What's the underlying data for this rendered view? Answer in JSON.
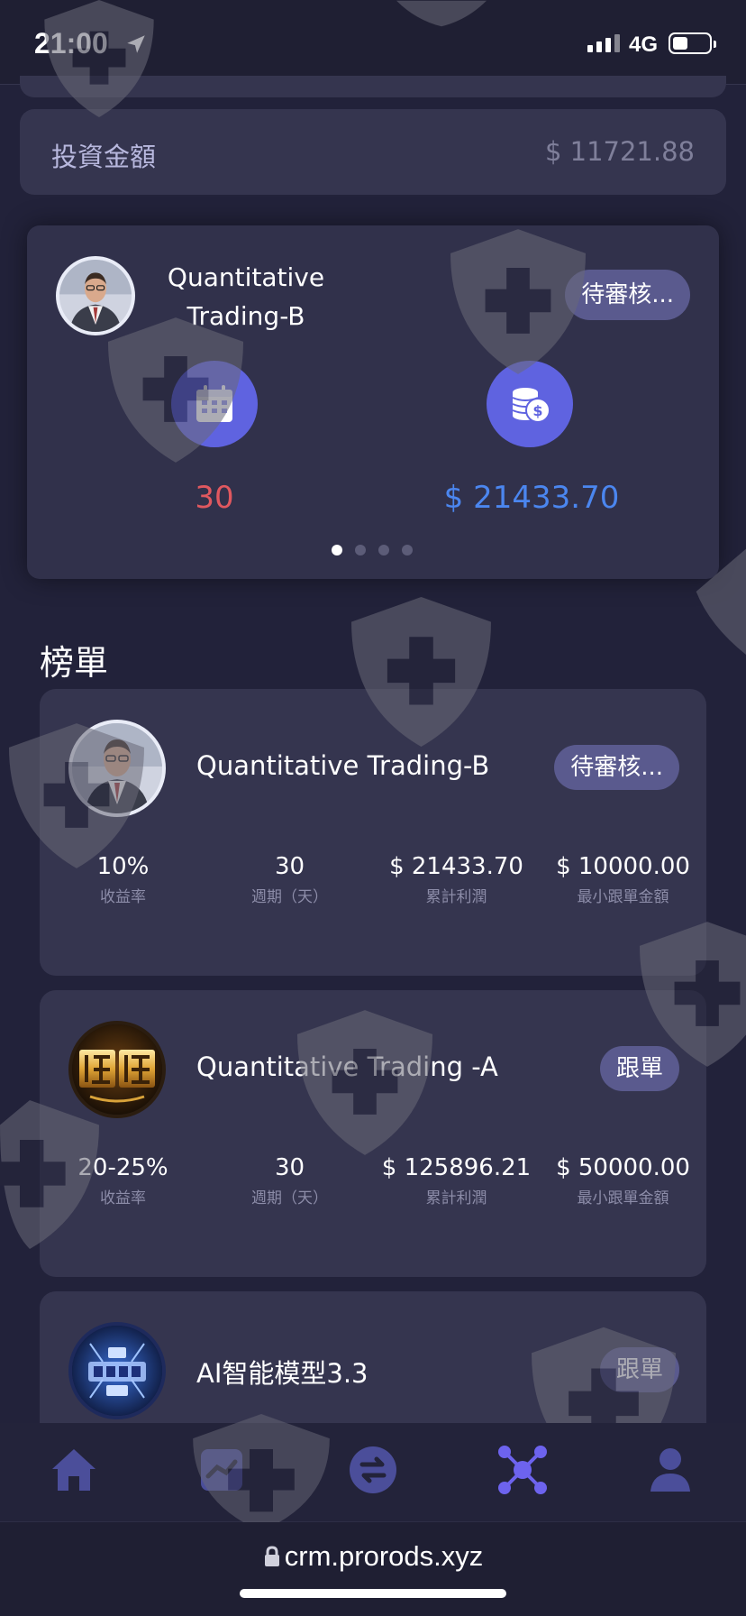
{
  "status": {
    "time": "21:00",
    "network": "4G"
  },
  "investment": {
    "label": "投資金額",
    "value": "$ 11721.88"
  },
  "carousel": {
    "title_line1": "Quantitative",
    "title_line2": "Trading-B",
    "status_label": "待審核...",
    "days": "30",
    "profit": "$ 21433.70",
    "page_count": 4,
    "active_page": 0
  },
  "leaderboard": {
    "title": "榜單",
    "items": [
      {
        "name": "Quantitative Trading-B",
        "action": "待審核...",
        "avatar": "portrait",
        "stats": [
          {
            "value": "10%",
            "label": "收益率"
          },
          {
            "value": "30",
            "label": "週期（天）"
          },
          {
            "value": "$ 21433.70",
            "label": "累計利潤"
          },
          {
            "value": "$ 10000.00",
            "label": "最小跟單金額"
          }
        ]
      },
      {
        "name": "Quantitative Trading -A",
        "action": "跟單",
        "avatar": "gold-logo",
        "stats": [
          {
            "value": "20-25%",
            "label": "收益率"
          },
          {
            "value": "30",
            "label": "週期（天）"
          },
          {
            "value": "$ 125896.21",
            "label": "累計利潤"
          },
          {
            "value": "$ 50000.00",
            "label": "最小跟單金額"
          }
        ]
      },
      {
        "name": "AI智能模型3.3",
        "action": "跟單",
        "avatar": "ai-logo"
      }
    ]
  },
  "tabs": [
    {
      "icon": "home-icon"
    },
    {
      "icon": "chart-icon"
    },
    {
      "icon": "exchange-icon"
    },
    {
      "icon": "network-icon",
      "active": true
    },
    {
      "icon": "user-icon"
    }
  ],
  "browser": {
    "url": "crm.prorods.xyz"
  },
  "colors": {
    "background": "#22223a",
    "card": "#35354f",
    "accent": "#5f63e0",
    "profit_blue": "#4b86ef",
    "days_red": "#e0585f",
    "pill": "#5a5a8e"
  }
}
